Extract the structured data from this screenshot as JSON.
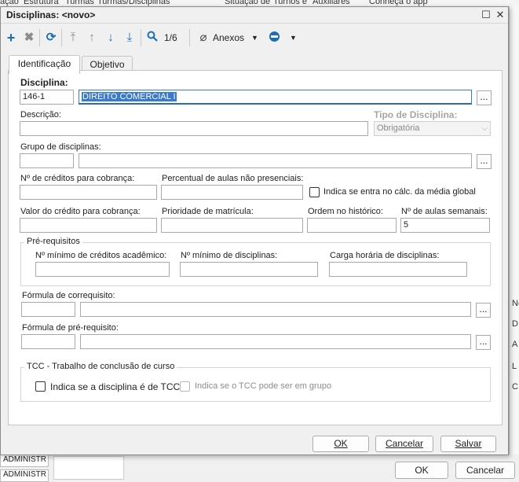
{
  "background": {
    "menu": [
      "ação",
      "Estrutura",
      "Turmas",
      "Turmas/Disciplinas",
      "Situação de",
      "Turnos e",
      "Auxiliares",
      "Conheça o app"
    ],
    "right_column": [
      "Nc",
      "D",
      "A",
      "L",
      "C"
    ],
    "left_cells": [
      "ADMINISTR",
      "ADMINISTR"
    ],
    "ok_label": "OK",
    "cancel_label": "Cancelar"
  },
  "dialog": {
    "title": "Disciplinas: <novo>",
    "toolbar": {
      "record_counter": "1/6",
      "attachments_label": "Anexos"
    },
    "tabs": [
      "Identificação",
      "Objetivo"
    ],
    "fields": {
      "disciplina_label": "Disciplina:",
      "disciplina_code": "146-1",
      "disciplina_name": "DIREITO COMERCIAL I",
      "descricao_label": "Descrição:",
      "descricao_value": "",
      "tipo_label": "Tipo de Disciplina:",
      "tipo_value": "Obrigatória",
      "grupo_label": "Grupo de disciplinas:",
      "creditos_cobranca_label": "Nº de créditos para cobrança:",
      "percentual_label": "Percentual de aulas não presenciais:",
      "media_global_label": "Indica se entra no cálc. da média global",
      "valor_credito_label": "Valor do crédito para cobrança:",
      "prioridade_label": "Prioridade de matrícula:",
      "ordem_label": "Ordem no histórico:",
      "aulas_semanais_label": "Nº de aulas semanais:",
      "aulas_semanais_value": "5",
      "prereq_group": "Pré-requisitos",
      "min_creditos_label": "Nº mínimo de créditos acadêmico:",
      "min_disciplinas_label": "Nº mínimo de disciplinas:",
      "carga_horaria_label": "Carga horária de disciplinas:",
      "formula_correq_label": "Fórmula de correquisito:",
      "formula_prereq_label": "Fórmula de pré-requisito:",
      "tcc_group": "TCC - Trabalho de conclusão de curso",
      "tcc_label": "Indica se a disciplina é de TCC",
      "tcc_grupo_label": "Indica se o TCC pode ser em grupo",
      "browse": "..."
    },
    "buttons": {
      "ok": "OK",
      "cancel": "Cancelar",
      "save": "Salvar"
    }
  },
  "colors": {
    "accent": "#1a6fb0",
    "selection": "#3b79c9"
  }
}
